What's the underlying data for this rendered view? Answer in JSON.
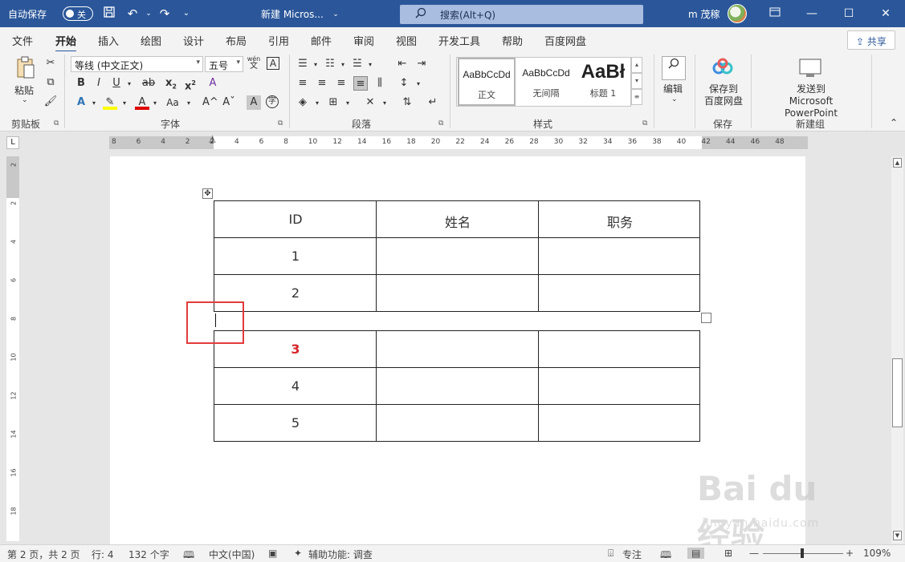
{
  "titlebar": {
    "autosave_label": "自动保存",
    "autosave_state": "关",
    "doc_title": "新建 Micros...",
    "search_placeholder": "搜索(Alt+Q)",
    "user_name": "m 茂稼",
    "accent_color": "#2b579a"
  },
  "tabs": [
    "文件",
    "开始",
    "插入",
    "绘图",
    "设计",
    "布局",
    "引用",
    "邮件",
    "审阅",
    "视图",
    "开发工具",
    "帮助",
    "百度网盘"
  ],
  "active_tab": "开始",
  "share_label": "共享",
  "ribbon": {
    "clipboard": {
      "paste_label": "粘贴",
      "group_label": "剪贴板"
    },
    "font": {
      "font_name": "等线 (中文正文)",
      "font_size": "五号",
      "wen": "wén",
      "wen_char": "文",
      "group_label": "字体"
    },
    "paragraph": {
      "group_label": "段落"
    },
    "styles": {
      "group_label": "样式",
      "items": [
        {
          "sample": "AaBbCcDd",
          "name": "正文"
        },
        {
          "sample": "AaBbCcDd",
          "name": "无间隔"
        },
        {
          "sample": "AaBł",
          "name": "标题 1"
        }
      ]
    },
    "editing": {
      "label": "编辑"
    },
    "save": {
      "label_line1": "保存到",
      "label_line2": "百度网盘",
      "group_label": "保存"
    },
    "newgroup": {
      "label_line1": "发送到",
      "label_line2": "Microsoft PowerPoint",
      "group_label": "新建组"
    }
  },
  "hruler_ticks": [
    "8",
    "6",
    "4",
    "2",
    "2",
    "4",
    "6",
    "8",
    "10",
    "12",
    "14",
    "16",
    "18",
    "20",
    "22",
    "24",
    "26",
    "28",
    "30",
    "32",
    "34",
    "36",
    "38",
    "40",
    "42",
    "44",
    "46",
    "48"
  ],
  "vruler_ticks": [
    "2",
    "2",
    "4",
    "6",
    "8",
    "10",
    "12",
    "14",
    "16",
    "18"
  ],
  "table": {
    "headers": [
      "ID",
      "姓名",
      "职务"
    ],
    "rows_top": [
      [
        "1",
        "",
        ""
      ],
      [
        "2",
        "",
        ""
      ]
    ],
    "rows_bottom": [
      [
        "3",
        "",
        ""
      ],
      [
        "4",
        "",
        ""
      ],
      [
        "5",
        "",
        ""
      ]
    ]
  },
  "watermark": {
    "brand": "Bai du 经验",
    "url": "jingyan.baidu.com"
  },
  "status": {
    "page": "第 2 页，共 2 页",
    "line": "行: 4",
    "words": "132 个字",
    "language": "中文(中国)",
    "accessibility": "辅助功能: 调查",
    "focus": "专注",
    "zoom": "109%"
  }
}
